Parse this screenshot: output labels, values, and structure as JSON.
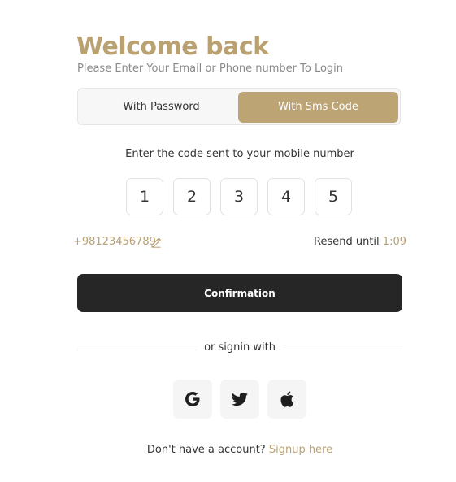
{
  "header": {
    "title": "Welcome back",
    "subtitle": "Please Enter Your Email or Phone number To Login"
  },
  "tabs": [
    {
      "label": "With Password",
      "active": false
    },
    {
      "label": "With Sms Code",
      "active": true
    }
  ],
  "code": {
    "prompt": "Enter the code sent to your mobile number",
    "digits": [
      "1",
      "2",
      "3",
      "4",
      "5"
    ]
  },
  "phone": {
    "number": "+98123456789",
    "edit_icon": "pencil-icon"
  },
  "resend": {
    "label": "Resend until",
    "timer": "1:09"
  },
  "confirm_label": "Confirmation",
  "divider_text": "or signin with",
  "social": {
    "icons": [
      "google-icon",
      "twitter-icon",
      "apple-icon"
    ]
  },
  "signup": {
    "prompt": "Don't have a account?",
    "link": "Signup here"
  },
  "colors": {
    "accent": "#bda474",
    "button_dark": "#262626",
    "text": "#333333",
    "muted": "#8a8a8a"
  }
}
